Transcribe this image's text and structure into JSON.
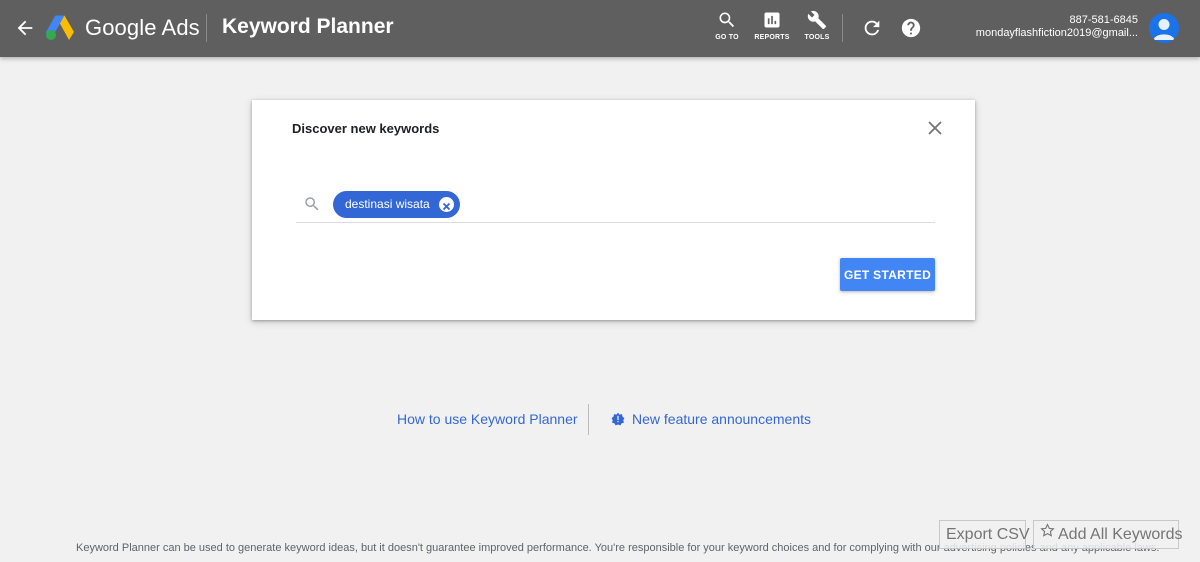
{
  "header": {
    "brand": "Google Ads",
    "page_title": "Keyword Planner",
    "tools": [
      {
        "label": "GO TO",
        "icon": "search-icon"
      },
      {
        "label": "REPORTS",
        "icon": "reports-icon"
      },
      {
        "label": "TOOLS",
        "icon": "wrench-icon"
      }
    ],
    "account": {
      "customer_id": "887-581-6845",
      "email": "mondayflashfiction2019@gmail..."
    }
  },
  "card": {
    "title": "Discover new keywords",
    "keyword_chip": "destinasi wisata",
    "input_value": "",
    "button_label": "GET STARTED"
  },
  "links": {
    "how_to": "How to use Keyword Planner",
    "announcements": "New feature announcements"
  },
  "footer": {
    "disclaimer": "Keyword Planner can be used to generate keyword ideas, but it doesn't guarantee improved performance. You're responsible for your keyword choices and for complying with our advertising policies and any applicable laws.",
    "export_csv": "Export CSV",
    "add_all_keywords": "Add All Keywords"
  },
  "colors": {
    "header_bg": "#5f5f5f",
    "page_bg": "#f1f1f1",
    "accent": "#4285f4",
    "chip": "#3367d6",
    "link": "#3367d6"
  }
}
